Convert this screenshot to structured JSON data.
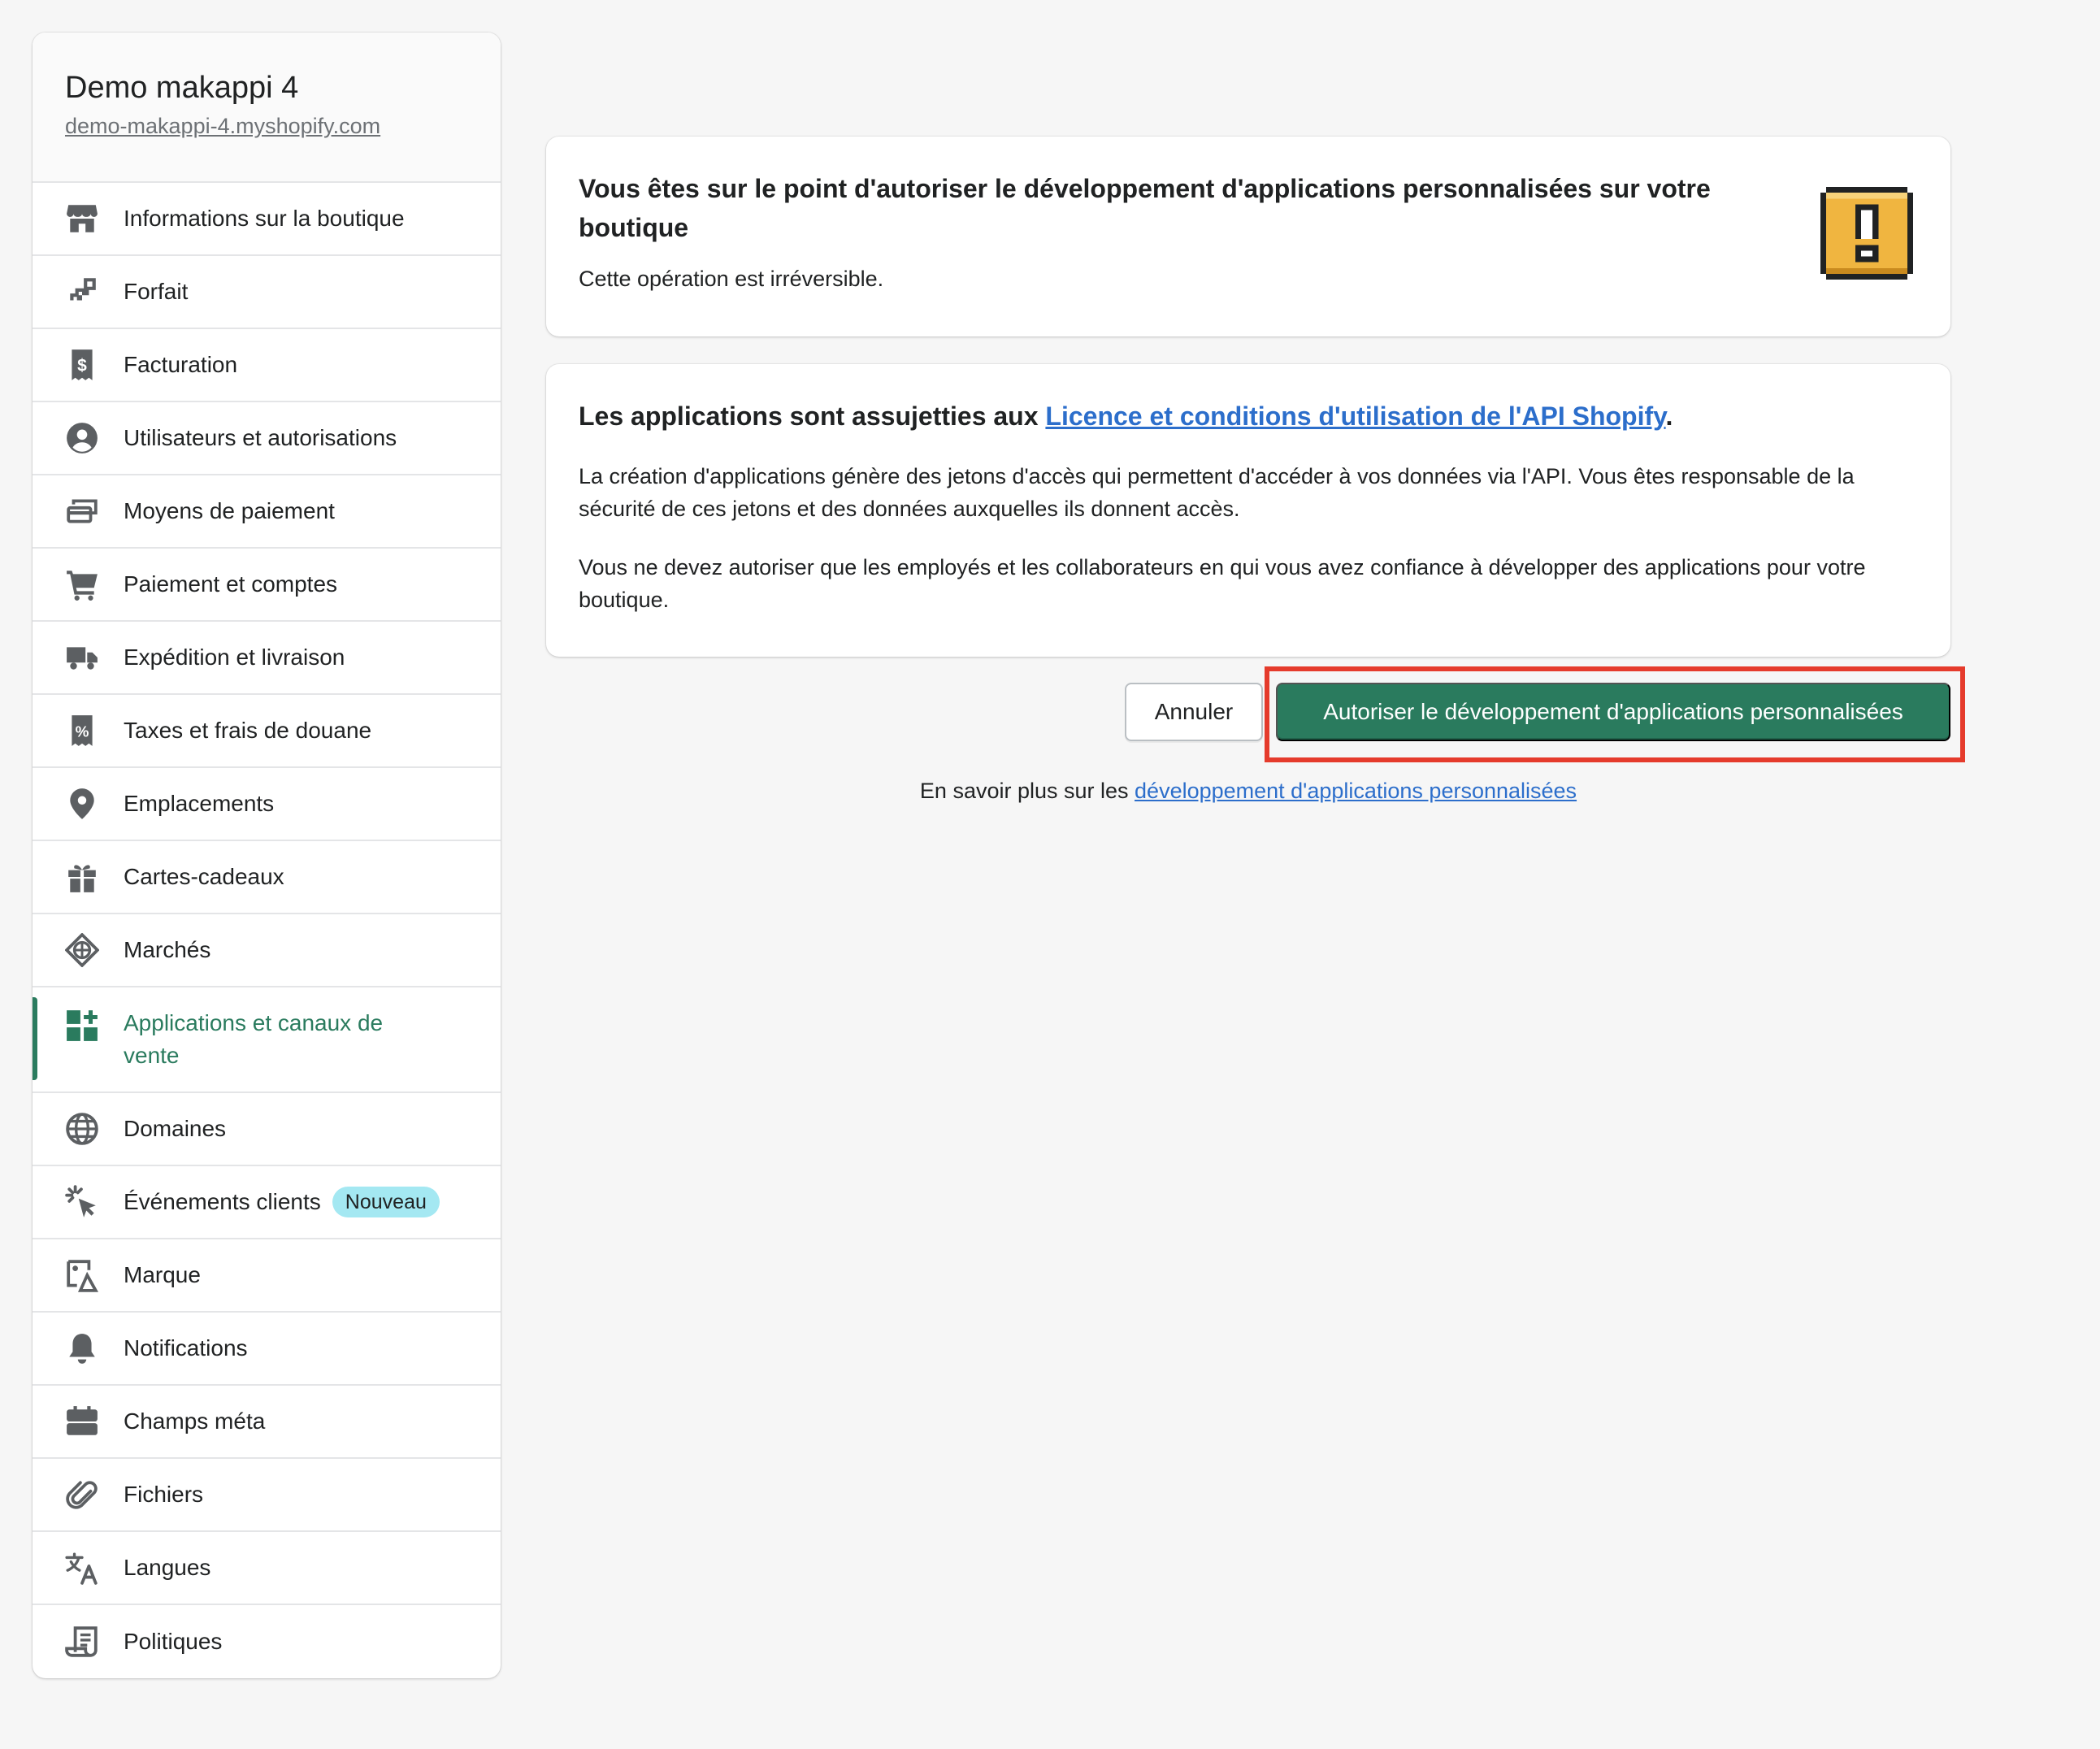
{
  "store": {
    "name": "Demo makappi 4",
    "url": "demo-makappi-4.myshopify.com"
  },
  "sidebar": {
    "items": [
      {
        "label": "Informations sur la boutique",
        "icon": "store-icon"
      },
      {
        "label": "Forfait",
        "icon": "plan-icon"
      },
      {
        "label": "Facturation",
        "icon": "billing-icon"
      },
      {
        "label": "Utilisateurs et autorisations",
        "icon": "user-icon"
      },
      {
        "label": "Moyens de paiement",
        "icon": "payment-icon"
      },
      {
        "label": "Paiement et comptes",
        "icon": "cart-icon"
      },
      {
        "label": "Expédition et livraison",
        "icon": "truck-icon"
      },
      {
        "label": "Taxes et frais de douane",
        "icon": "tax-icon"
      },
      {
        "label": "Emplacements",
        "icon": "location-icon"
      },
      {
        "label": "Cartes-cadeaux",
        "icon": "gift-icon"
      },
      {
        "label": "Marchés",
        "icon": "markets-icon"
      },
      {
        "label": "Applications et canaux de vente",
        "icon": "apps-icon",
        "active": true
      },
      {
        "label": "Domaines",
        "icon": "globe-icon"
      },
      {
        "label": "Événements clients",
        "icon": "cursor-icon",
        "badge": "Nouveau"
      },
      {
        "label": "Marque",
        "icon": "brand-icon"
      },
      {
        "label": "Notifications",
        "icon": "bell-icon"
      },
      {
        "label": "Champs méta",
        "icon": "metafields-icon"
      },
      {
        "label": "Fichiers",
        "icon": "paperclip-icon"
      },
      {
        "label": "Langues",
        "icon": "translate-icon"
      },
      {
        "label": "Politiques",
        "icon": "policy-icon"
      }
    ]
  },
  "warning_card": {
    "title": "Vous êtes sur le point d'autoriser le développement d'applications personnalisées sur votre boutique",
    "subtitle": "Cette opération est irréversible.",
    "icon": "warning-exclamation-icon"
  },
  "terms_card": {
    "title_prefix": "Les applications sont assujetties aux ",
    "title_link": "Licence et conditions d'utilisation de l'API Shopify",
    "title_suffix": ".",
    "paragraph1": "La création d'applications génère des jetons d'accès qui permettent d'accéder à vos données via l'API. Vous êtes responsable de la sécurité de ces jetons et des données auxquelles ils donnent accès.",
    "paragraph2": "Vous ne devez autoriser que les employés et les collaborateurs en qui vous avez confiance à développer des applications pour votre boutique."
  },
  "actions": {
    "cancel_label": "Annuler",
    "confirm_label": "Autoriser le développement d'applications personnalisées"
  },
  "learn_more": {
    "prefix": "En savoir plus sur les ",
    "link": "développement d'applications personnalisées"
  },
  "colors": {
    "accent_green": "#2a7b5e",
    "link_blue": "#2c6ecb",
    "highlight_red": "#e53b2c",
    "badge_bg": "#a4e8f2",
    "warning_yellow": "#f0b540"
  }
}
